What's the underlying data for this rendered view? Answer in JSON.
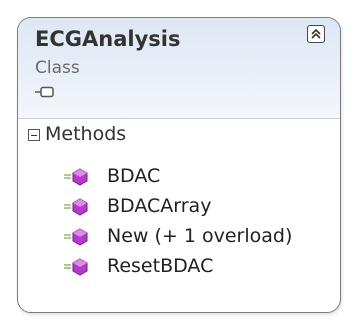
{
  "class_shape": {
    "name": "ECGAnalysis",
    "kind": "Class",
    "sections": [
      {
        "title": "Methods",
        "members": [
          {
            "label": "BDAC",
            "icon": "method-icon"
          },
          {
            "label": "BDACArray",
            "icon": "method-icon"
          },
          {
            "label": "New (+ 1 overload)",
            "icon": "method-icon"
          },
          {
            "label": "ResetBDAC",
            "icon": "method-icon"
          }
        ]
      }
    ]
  },
  "colors": {
    "header_gradient_top": "#dde7f4",
    "border": "#7c7c7c",
    "method_icon": "#b23cc9"
  }
}
